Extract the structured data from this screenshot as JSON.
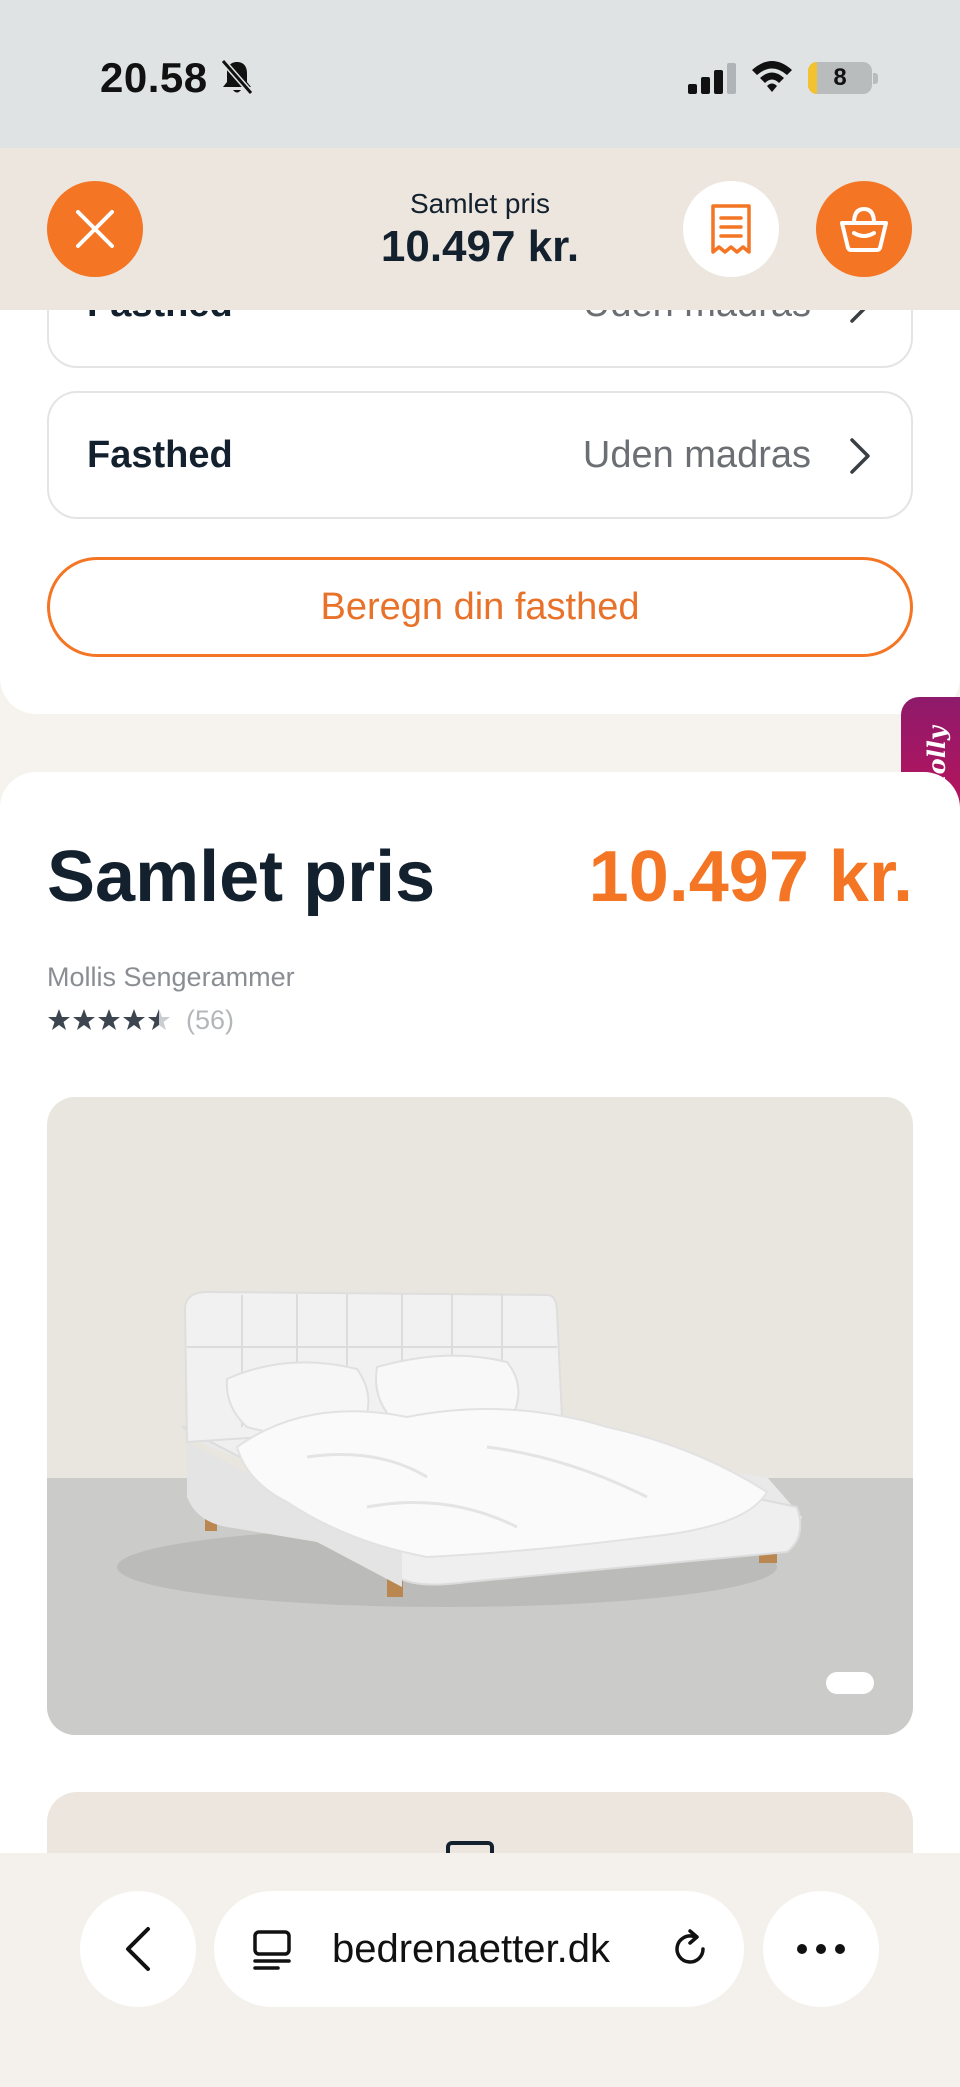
{
  "status_bar": {
    "time": "20.58",
    "battery_level": "8",
    "battery_fraction": 0.14,
    "icons": [
      "bell-muted-icon",
      "cellular-signal-icon",
      "wifi-icon",
      "battery-icon"
    ]
  },
  "header": {
    "total_label": "Samlet pris",
    "total_price": "10.497 kr.",
    "icons": [
      "close-icon",
      "receipt-icon",
      "basket-icon"
    ],
    "accent_color": "#f47523"
  },
  "options": [
    {
      "label": "Fasthed",
      "value": "Uden madras"
    },
    {
      "label": "Fasthed",
      "value": "Uden madras"
    }
  ],
  "calculate_button": "Beregn din fasthed",
  "chat_widget": {
    "label": "Molly"
  },
  "summary": {
    "title": "Samlet pris",
    "price": "10.497 kr.",
    "product_name": "Mollis Sengerammer",
    "rating_value": 4.5,
    "rating_max": 5,
    "review_count": "(56)"
  },
  "product_image": {
    "pager_index": 1
  },
  "browser": {
    "url": "bedrenaetter.dk",
    "icons": [
      "back-chevron-icon",
      "page-icon",
      "reload-icon",
      "more-icon"
    ]
  }
}
